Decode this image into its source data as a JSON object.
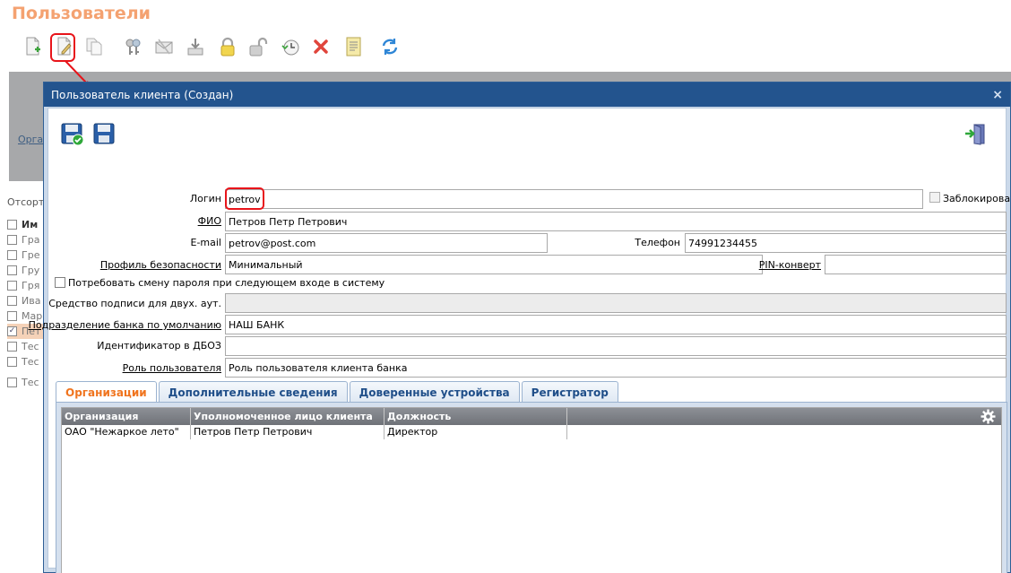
{
  "page": {
    "title": "Пользователи",
    "bg_org_link": "Орга",
    "bg_sort_label": "Отсорти",
    "bg_list": {
      "header": "Им",
      "rows": [
        "Гра",
        "Гре",
        "Гру",
        "Гря",
        "Ива",
        "Мар",
        "Пет",
        "Тес",
        "Тес",
        "Тес"
      ]
    }
  },
  "toolbar": [
    {
      "name": "new-doc-icon"
    },
    {
      "name": "edit-doc-icon"
    },
    {
      "name": "copy-doc-icon"
    },
    {
      "name": "keys-icon"
    },
    {
      "name": "mail-icon"
    },
    {
      "name": "download-icon"
    },
    {
      "name": "lock-icon"
    },
    {
      "name": "unlock-icon"
    },
    {
      "name": "history-icon"
    },
    {
      "name": "delete-icon"
    },
    {
      "name": "report-icon"
    },
    {
      "name": "refresh-icon"
    }
  ],
  "dialog": {
    "title": "Пользователь клиента (Создан)",
    "close": "×",
    "login_label": "Логин",
    "login_value": "petrov",
    "blocked_label": "Заблокирован",
    "fio_label": "ФИО",
    "fio_value": "Петров Петр Петрович",
    "email_label": "E-mail",
    "email_value": "petrov@post.com",
    "phone_label": "Телефон",
    "phone_value": "74991234455",
    "security_profile_label": "Профиль безопасности",
    "security_profile_value": "Минимальный",
    "pin_label": "PIN-конверт",
    "pin_value": "",
    "change_password_label": "Потребовать смену пароля при следующем входе в систему",
    "signature_label": "Средство подписи для двух. аут.",
    "signature_value": "",
    "department_label": "Подразделение банка по умолчанию",
    "department_value": "НАШ БАНК",
    "dboz_label": "Идентификатор в ДБОЗ",
    "dboz_value": "",
    "role_label": "Роль пользователя",
    "role_value": "Роль пользователя клиента банка"
  },
  "tabs": [
    {
      "label": "Организации",
      "active": true
    },
    {
      "label": "Дополнительные сведения",
      "active": false
    },
    {
      "label": "Доверенные устройства",
      "active": false
    },
    {
      "label": "Регистратор",
      "active": false
    }
  ],
  "grid": {
    "columns": [
      "Организация",
      "Уполномоченное лицо клиента",
      "Должность"
    ],
    "rows": [
      [
        "ОАО \"Нежаркое лето\"",
        "Петров Петр Петрович",
        "Директор"
      ]
    ]
  },
  "colors": {
    "accent_title": "#f4a271",
    "dialog_header": "#23548e",
    "active_tab": "#f0741e",
    "highlight": "#e8141a"
  }
}
